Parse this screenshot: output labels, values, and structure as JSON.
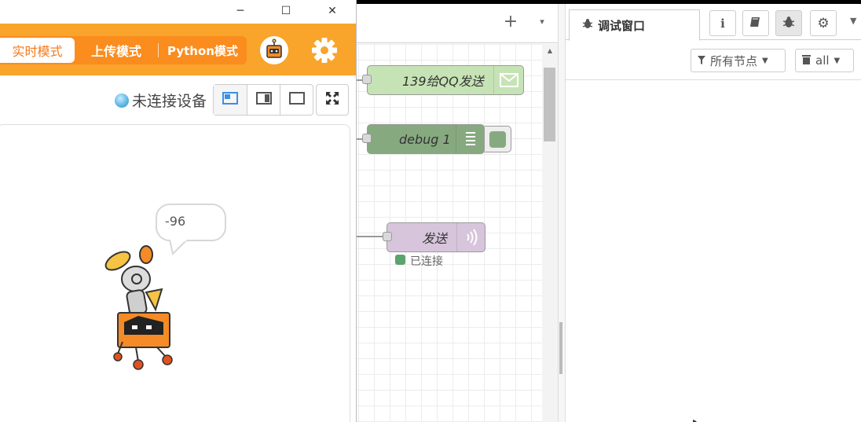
{
  "workspace": {
    "add_symbol": "+",
    "menu_symbol": "▾",
    "nodes": {
      "email": {
        "label": "139给QQ发送",
        "color": "#c0deed"
      },
      "debug": {
        "label": "debug 1",
        "color": "#87a980"
      },
      "send": {
        "label": "发送",
        "color": "#d7c5dc",
        "status": "已连接",
        "status_color": "#5ba36f"
      }
    }
  },
  "sidebar": {
    "active_tab": "调试窗口",
    "buttons": [
      "info-icon",
      "book-icon",
      "bug-icon",
      "gear-icon"
    ],
    "filter_label": "所有节点",
    "clear_label": "all"
  },
  "window": {
    "controls": [
      "─",
      "☐",
      "✕"
    ],
    "modes": {
      "live": "实时模式",
      "upload": "上传模式",
      "python": "Python模式"
    },
    "status": "未连接设备",
    "bubble_value": "-96"
  },
  "colors": {
    "toolbar_orange": "#f9a42a",
    "mode_active_text": "#f37a1b"
  }
}
